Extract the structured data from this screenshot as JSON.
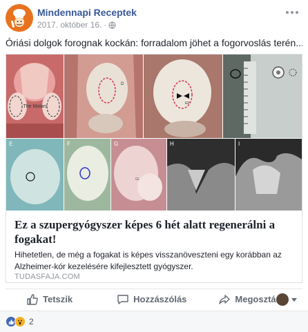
{
  "page": {
    "name": "Mindennapi Receptek",
    "date": "2017. október 16.",
    "separator": "·",
    "privacy_icon": "globe-icon",
    "more_icon": "more-options-icon"
  },
  "post": {
    "text": "Óriási dolgok forognak kockán: forradalom jöhet a fogorvoslás terén..."
  },
  "link": {
    "title": "Ez a szupergyógyszer képes 6 hét alatt regenerálni a fogakat!",
    "description": "Hihetetlen, de még a fogakat is képes visszanöveszteni egy korábban az Alzheimer-kór kezelésére kifejlesztett gyógyszer.",
    "domain": "TUDASFAJA.COM",
    "image_labels": {
      "a": "The Molars",
      "b": "D",
      "c": "EP",
      "e": "E",
      "f": "F",
      "g": "G",
      "g_inner": "GI",
      "h": "H",
      "i": "I"
    }
  },
  "actions": {
    "like": "Tetszik",
    "comment": "Hozzászólás",
    "share": "Megosztás"
  },
  "reactions": {
    "count": "2",
    "types": [
      "like-reaction-icon",
      "wow-reaction-icon"
    ],
    "colors": {
      "like": "#4267b2",
      "wow": "#f7b125"
    }
  },
  "colors": {
    "link_blue": "#365899",
    "meta_gray": "#90949c",
    "avatar_orange": "#e8731f"
  }
}
